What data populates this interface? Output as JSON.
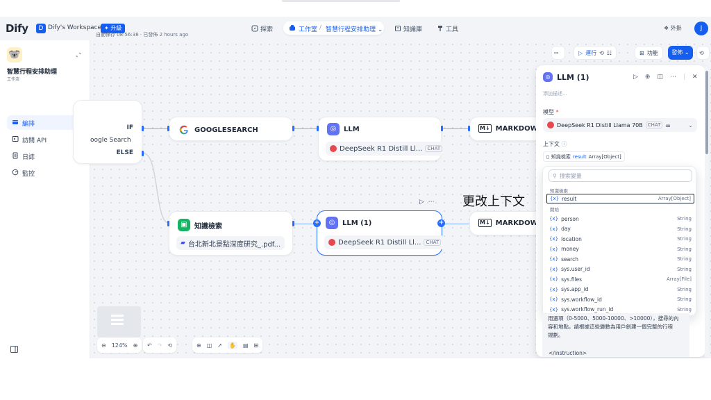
{
  "header": {
    "logo": "Dify",
    "workspace_initial": "D",
    "workspace_name": "Dify's Workspace",
    "upgrade": "升級",
    "nav_explore": "探索",
    "nav_studio": "工作室",
    "nav_app": "智慧行程安排助理",
    "nav_knowledge": "知識庫",
    "nav_tools": "工具",
    "plugins": "外掛",
    "user_initial": "J"
  },
  "sidebar": {
    "app_name": "智慧行程安排助理",
    "app_type": "工作流",
    "items": [
      {
        "label": "編排",
        "icon": "layout-icon"
      },
      {
        "label": "訪問 API",
        "icon": "terminal-icon"
      },
      {
        "label": "日誌",
        "icon": "file-list-icon"
      },
      {
        "label": "監控",
        "icon": "dashboard-icon"
      }
    ]
  },
  "canvas": {
    "autosave": "自動保存 08:56:38 · 已發佈 2 hours ago",
    "if_label": "IF",
    "search_label": "oogle Search",
    "else_label": "ELSE",
    "google_node": "GOOGLESEARCH",
    "llm_node": "LLM",
    "llm_model": "DeepSeek R1 Distill Ll...",
    "chat_tag": "CHAT",
    "markdown_1": "MARKDOWN",
    "knowledge_node": "知識檢索",
    "knowledge_file": "台北新北景點深度研究_.pdf...",
    "llm1_node": "LLM (1)",
    "llm1_model": "DeepSeek R1 Distill Ll...",
    "markdown_2": "MARKDOWN",
    "annotation": "更改上下文",
    "zoom": "124%"
  },
  "toolbar": {
    "run": "運行",
    "features": "功能",
    "publish": "發佈"
  },
  "panel": {
    "title": "LLM (1)",
    "desc_placeholder": "添加描述...",
    "model_label": "模型",
    "model_required": "*",
    "model_name": "DeepSeek R1 Distill Llama 70B",
    "model_tag": "CHAT",
    "context_label": "上下文",
    "context_source": "知識檢索",
    "context_var": "result",
    "context_type": "Array[Object]",
    "search_placeholder": "搜索變量",
    "group_knowledge": "知識檢索",
    "group_start": "開始",
    "vars_knowledge": [
      {
        "name": "result",
        "type": "Array[Object]"
      }
    ],
    "vars_start": [
      {
        "name": "person",
        "type": "String"
      },
      {
        "name": "day",
        "type": "String"
      },
      {
        "name": "location",
        "type": "String"
      },
      {
        "name": "money",
        "type": "String"
      },
      {
        "name": "search",
        "type": "String"
      },
      {
        "name": "sys.user_id",
        "type": "String"
      },
      {
        "name": "sys.files",
        "type": "Array[File]"
      },
      {
        "name": "sys.app_id",
        "type": "String"
      },
      {
        "name": "sys.workflow_id",
        "type": "String"
      },
      {
        "name": "sys.workflow_run_id",
        "type": "String"
      }
    ],
    "prompt_line1": "用選項（0-5000、5000-10000、>10000），搜尋的內",
    "prompt_line2": "容和地點，請根據這些變數為用戶創建一個完整的行程",
    "prompt_line3": "規劃。",
    "prompt_end": "</instruction>"
  }
}
